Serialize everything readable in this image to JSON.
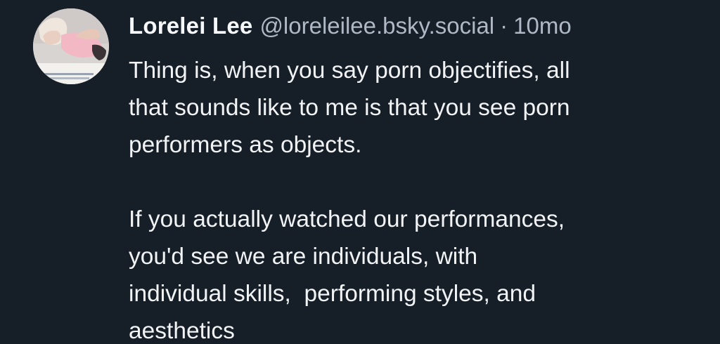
{
  "post": {
    "author_name": "Lorelei Lee",
    "author_handle": "@loreleilee.bsky.social",
    "separator": "·",
    "timestamp": "10mo",
    "paragraphs": [
      {
        "lines": [
          "Thing is, when you say porn objectifies, all",
          "that sounds like to me is that you see porn",
          "performers as objects."
        ]
      },
      {
        "lines": [
          "If you actually watched our performances,",
          "you'd see we are individuals, with",
          "individual skills,  performing styles, and",
          "aesthetics"
        ]
      }
    ]
  },
  "icons": {
    "avatar": "user-avatar-photo"
  },
  "colors": {
    "background": "#161e27",
    "text_primary": "#f1f3f5",
    "text_secondary": "#aeb9c5"
  }
}
